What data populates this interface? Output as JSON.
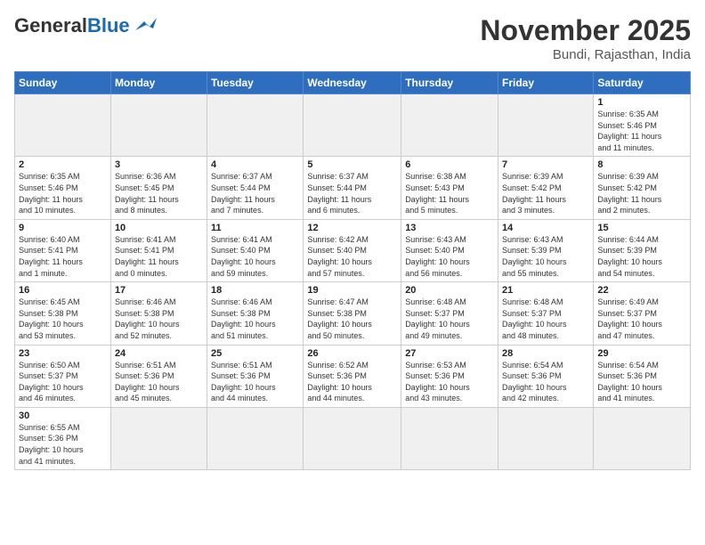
{
  "header": {
    "logo_general": "General",
    "logo_blue": "Blue",
    "month_title": "November 2025",
    "location": "Bundi, Rajasthan, India"
  },
  "days_of_week": [
    "Sunday",
    "Monday",
    "Tuesday",
    "Wednesday",
    "Thursday",
    "Friday",
    "Saturday"
  ],
  "weeks": [
    [
      {
        "day": "",
        "info": ""
      },
      {
        "day": "",
        "info": ""
      },
      {
        "day": "",
        "info": ""
      },
      {
        "day": "",
        "info": ""
      },
      {
        "day": "",
        "info": ""
      },
      {
        "day": "",
        "info": ""
      },
      {
        "day": "1",
        "info": "Sunrise: 6:35 AM\nSunset: 5:46 PM\nDaylight: 11 hours\nand 11 minutes."
      }
    ],
    [
      {
        "day": "2",
        "info": "Sunrise: 6:35 AM\nSunset: 5:46 PM\nDaylight: 11 hours\nand 10 minutes."
      },
      {
        "day": "3",
        "info": "Sunrise: 6:36 AM\nSunset: 5:45 PM\nDaylight: 11 hours\nand 8 minutes."
      },
      {
        "day": "4",
        "info": "Sunrise: 6:37 AM\nSunset: 5:44 PM\nDaylight: 11 hours\nand 7 minutes."
      },
      {
        "day": "5",
        "info": "Sunrise: 6:37 AM\nSunset: 5:44 PM\nDaylight: 11 hours\nand 6 minutes."
      },
      {
        "day": "6",
        "info": "Sunrise: 6:38 AM\nSunset: 5:43 PM\nDaylight: 11 hours\nand 5 minutes."
      },
      {
        "day": "7",
        "info": "Sunrise: 6:39 AM\nSunset: 5:42 PM\nDaylight: 11 hours\nand 3 minutes."
      },
      {
        "day": "8",
        "info": "Sunrise: 6:39 AM\nSunset: 5:42 PM\nDaylight: 11 hours\nand 2 minutes."
      }
    ],
    [
      {
        "day": "9",
        "info": "Sunrise: 6:40 AM\nSunset: 5:41 PM\nDaylight: 11 hours\nand 1 minute."
      },
      {
        "day": "10",
        "info": "Sunrise: 6:41 AM\nSunset: 5:41 PM\nDaylight: 11 hours\nand 0 minutes."
      },
      {
        "day": "11",
        "info": "Sunrise: 6:41 AM\nSunset: 5:40 PM\nDaylight: 10 hours\nand 59 minutes."
      },
      {
        "day": "12",
        "info": "Sunrise: 6:42 AM\nSunset: 5:40 PM\nDaylight: 10 hours\nand 57 minutes."
      },
      {
        "day": "13",
        "info": "Sunrise: 6:43 AM\nSunset: 5:40 PM\nDaylight: 10 hours\nand 56 minutes."
      },
      {
        "day": "14",
        "info": "Sunrise: 6:43 AM\nSunset: 5:39 PM\nDaylight: 10 hours\nand 55 minutes."
      },
      {
        "day": "15",
        "info": "Sunrise: 6:44 AM\nSunset: 5:39 PM\nDaylight: 10 hours\nand 54 minutes."
      }
    ],
    [
      {
        "day": "16",
        "info": "Sunrise: 6:45 AM\nSunset: 5:38 PM\nDaylight: 10 hours\nand 53 minutes."
      },
      {
        "day": "17",
        "info": "Sunrise: 6:46 AM\nSunset: 5:38 PM\nDaylight: 10 hours\nand 52 minutes."
      },
      {
        "day": "18",
        "info": "Sunrise: 6:46 AM\nSunset: 5:38 PM\nDaylight: 10 hours\nand 51 minutes."
      },
      {
        "day": "19",
        "info": "Sunrise: 6:47 AM\nSunset: 5:38 PM\nDaylight: 10 hours\nand 50 minutes."
      },
      {
        "day": "20",
        "info": "Sunrise: 6:48 AM\nSunset: 5:37 PM\nDaylight: 10 hours\nand 49 minutes."
      },
      {
        "day": "21",
        "info": "Sunrise: 6:48 AM\nSunset: 5:37 PM\nDaylight: 10 hours\nand 48 minutes."
      },
      {
        "day": "22",
        "info": "Sunrise: 6:49 AM\nSunset: 5:37 PM\nDaylight: 10 hours\nand 47 minutes."
      }
    ],
    [
      {
        "day": "23",
        "info": "Sunrise: 6:50 AM\nSunset: 5:37 PM\nDaylight: 10 hours\nand 46 minutes."
      },
      {
        "day": "24",
        "info": "Sunrise: 6:51 AM\nSunset: 5:36 PM\nDaylight: 10 hours\nand 45 minutes."
      },
      {
        "day": "25",
        "info": "Sunrise: 6:51 AM\nSunset: 5:36 PM\nDaylight: 10 hours\nand 44 minutes."
      },
      {
        "day": "26",
        "info": "Sunrise: 6:52 AM\nSunset: 5:36 PM\nDaylight: 10 hours\nand 44 minutes."
      },
      {
        "day": "27",
        "info": "Sunrise: 6:53 AM\nSunset: 5:36 PM\nDaylight: 10 hours\nand 43 minutes."
      },
      {
        "day": "28",
        "info": "Sunrise: 6:54 AM\nSunset: 5:36 PM\nDaylight: 10 hours\nand 42 minutes."
      },
      {
        "day": "29",
        "info": "Sunrise: 6:54 AM\nSunset: 5:36 PM\nDaylight: 10 hours\nand 41 minutes."
      }
    ],
    [
      {
        "day": "30",
        "info": "Sunrise: 6:55 AM\nSunset: 5:36 PM\nDaylight: 10 hours\nand 41 minutes."
      },
      {
        "day": "",
        "info": ""
      },
      {
        "day": "",
        "info": ""
      },
      {
        "day": "",
        "info": ""
      },
      {
        "day": "",
        "info": ""
      },
      {
        "day": "",
        "info": ""
      },
      {
        "day": "",
        "info": ""
      }
    ]
  ]
}
